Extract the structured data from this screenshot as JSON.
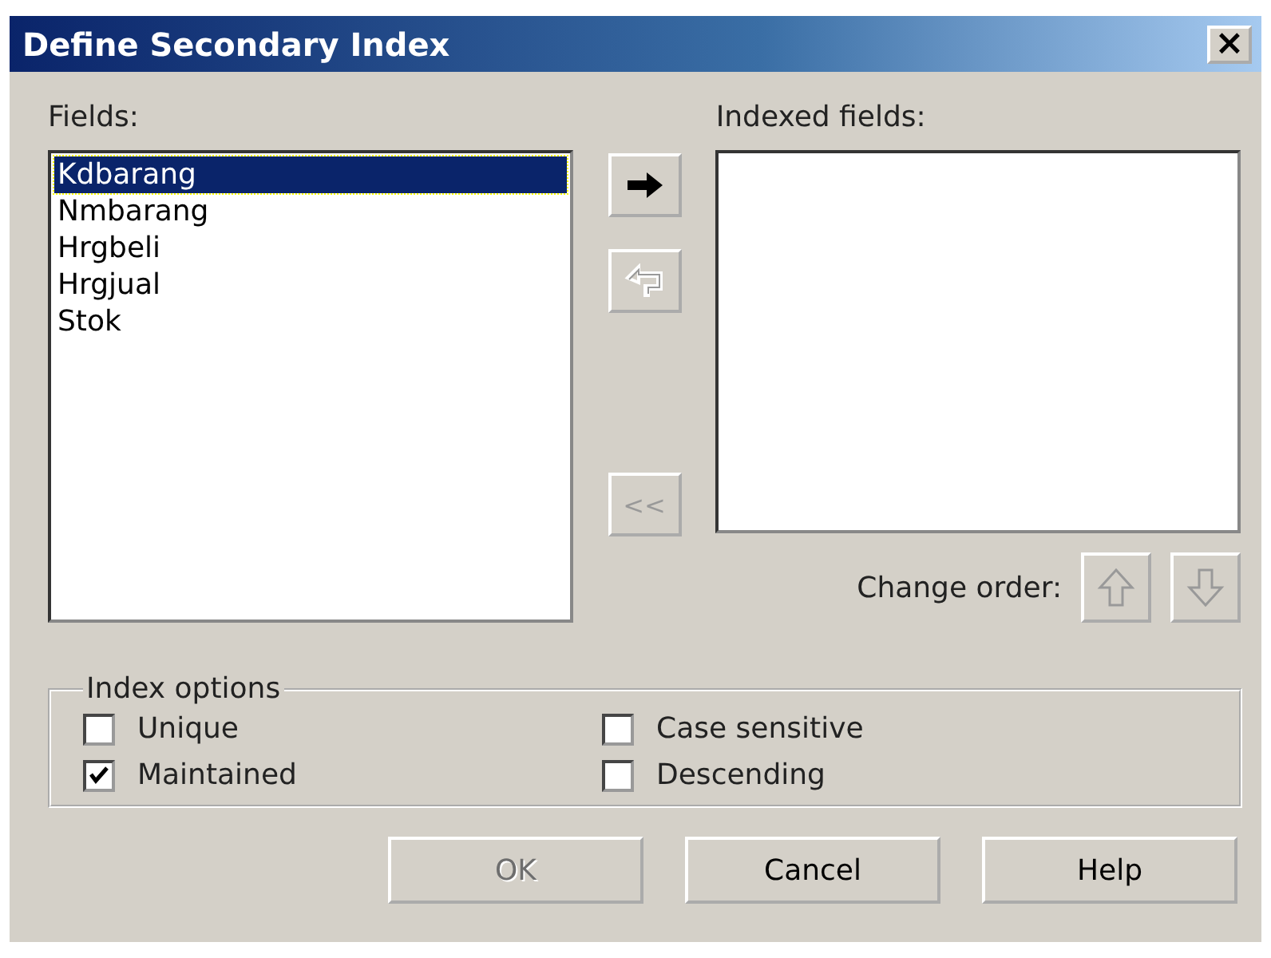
{
  "window": {
    "title": "Define Secondary Index",
    "close": "×"
  },
  "fields": {
    "label": "Fields:",
    "items": [
      {
        "label": "Kdbarang",
        "selected": true
      },
      {
        "label": "Nmbarang",
        "selected": false
      },
      {
        "label": "Hrgbeli",
        "selected": false
      },
      {
        "label": "Hrgjual",
        "selected": false
      },
      {
        "label": "Stok",
        "selected": false
      }
    ]
  },
  "move_buttons": [
    {
      "kind": "add",
      "disabled": false
    },
    {
      "kind": "remove",
      "disabled": true
    },
    {
      "kind": "clear",
      "text": "<<",
      "disabled": true
    }
  ],
  "indexed_fields": {
    "label": "Indexed fields:"
  },
  "change_order": {
    "label": "Change order:",
    "buttons": [
      {
        "kind": "up",
        "disabled": true
      },
      {
        "kind": "down",
        "disabled": true
      }
    ]
  },
  "index_options": {
    "title": "Index options",
    "options": [
      {
        "label": "Unique",
        "checked": false
      },
      {
        "label": "Case sensitive",
        "checked": false
      },
      {
        "label": "Maintained",
        "checked": true
      },
      {
        "label": "Descending",
        "checked": false
      }
    ]
  },
  "buttons": [
    {
      "label": "OK",
      "disabled": true
    },
    {
      "label": "Cancel",
      "disabled": false
    },
    {
      "label": "Help",
      "disabled": false
    }
  ]
}
